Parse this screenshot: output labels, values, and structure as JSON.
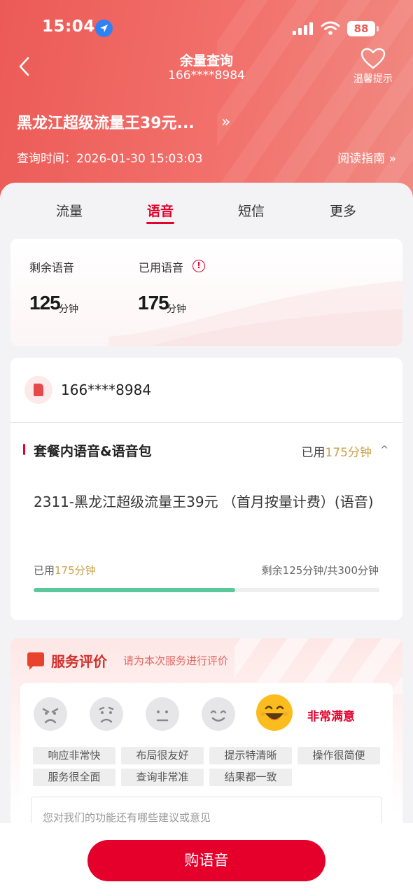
{
  "status_bar": {
    "time": "15:04",
    "battery": "88"
  },
  "header": {
    "title": "余量查询",
    "subtitle": "166****8984",
    "tips_label": "温馨提示",
    "plan_name": "黑龙江超级流量王39元...",
    "query_time": "查询时间：2026-01-30 15:03:03",
    "guide_label": "阅读指南 »"
  },
  "tabs": [
    {
      "label": "流量"
    },
    {
      "label": "语音"
    },
    {
      "label": "短信"
    },
    {
      "label": "更多"
    }
  ],
  "summary": {
    "remaining_label": "剩余语音",
    "remaining_value": "125",
    "remaining_unit": "分钟",
    "used_label": "已用语音",
    "used_value": "175",
    "used_unit": "分钟"
  },
  "package": {
    "phone": "166****8984",
    "section_title": "套餐内语音&语音包",
    "used_prefix": "已用",
    "used_amount": "175分钟",
    "name": "2311-黑龙江超级流量王39元  （首月按量计费）(语音)",
    "used_amount_bottom": "175分钟",
    "remaining_text": "剩余125分钟/共300分钟",
    "progress_fraction": 0.583
  },
  "evaluation": {
    "title": "服务评价",
    "subtitle": "请为本次服务进行评价",
    "verdict": "非常满意",
    "tags": [
      "响应非常快",
      "布局很友好",
      "提示特清晰",
      "操作很简便",
      "服务很全面",
      "查询非常准",
      "结果都一致"
    ],
    "placeholder": "您对我们的功能还有哪些建议或意见"
  },
  "footer": {
    "buy_label": "购语音"
  },
  "colors": {
    "brand_red": "#e4002b",
    "progress_green": "#5ac89a",
    "gold": "#c9a24a"
  }
}
